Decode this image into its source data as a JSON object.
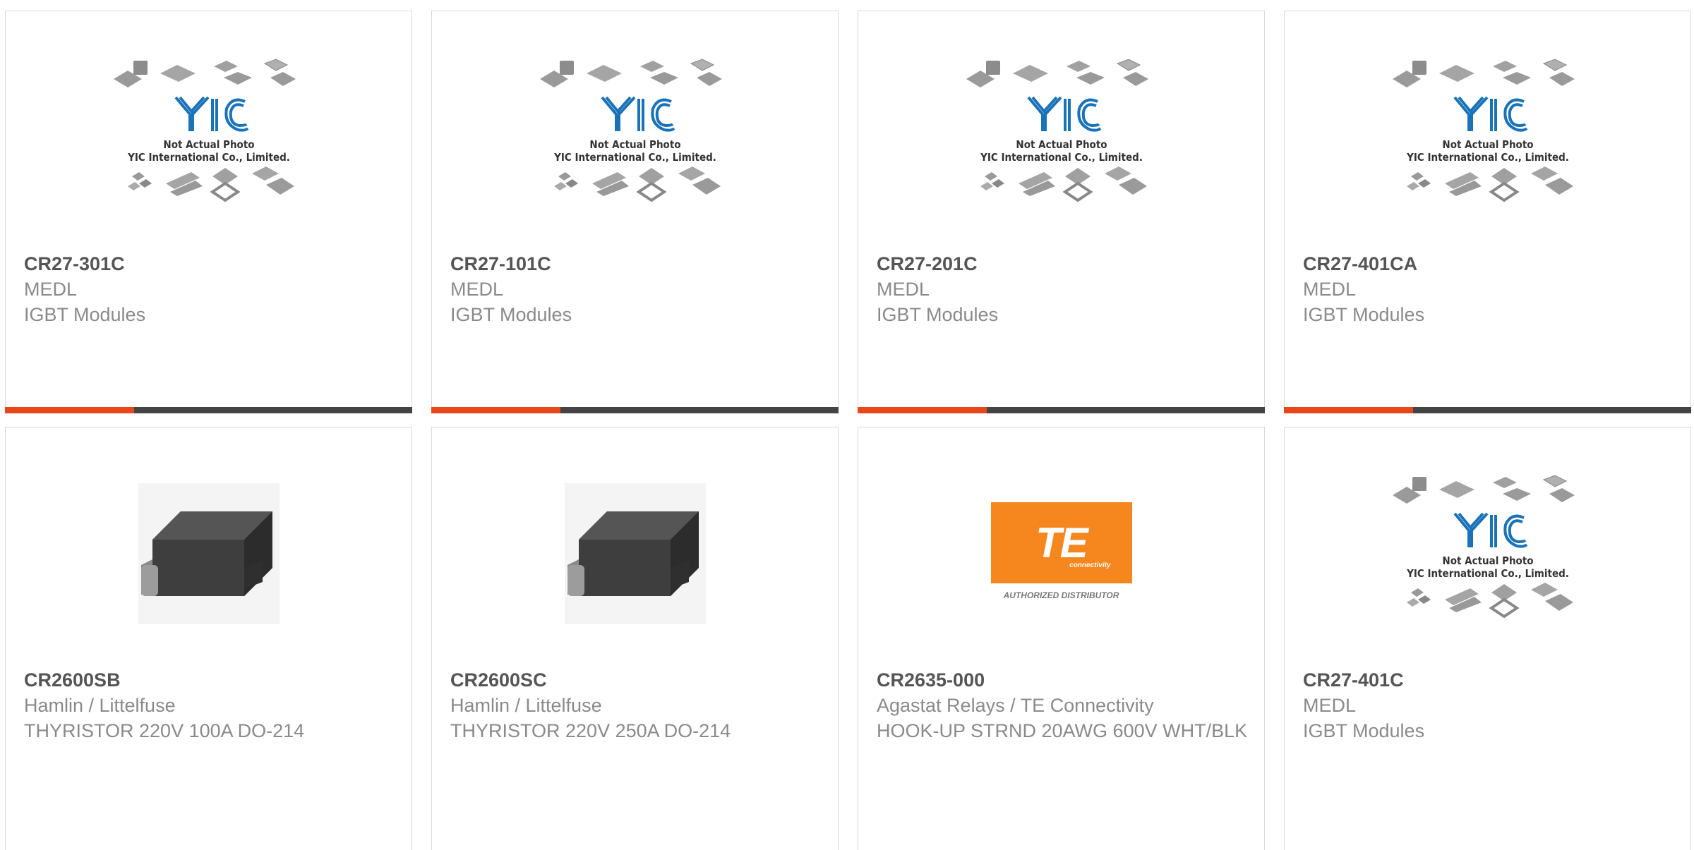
{
  "placeholder": {
    "line1": "Not Actual Photo",
    "line2": "YIC International Co., Limited.",
    "logo": "YIC"
  },
  "te": {
    "logo_text": "TE",
    "sub_text": "connectivity",
    "distributor": "AUTHORIZED DISTRIBUTOR"
  },
  "products": [
    {
      "pn": "CR27-301C",
      "mfr": "MEDL",
      "desc": "IGBT Modules",
      "image": "yic-placeholder"
    },
    {
      "pn": "CR27-101C",
      "mfr": "MEDL",
      "desc": "IGBT Modules",
      "image": "yic-placeholder"
    },
    {
      "pn": "CR27-201C",
      "mfr": "MEDL",
      "desc": "IGBT Modules",
      "image": "yic-placeholder"
    },
    {
      "pn": "CR27-401CA",
      "mfr": "MEDL",
      "desc": "IGBT Modules",
      "image": "yic-placeholder"
    },
    {
      "pn": "CR2600SB",
      "mfr": "Hamlin / Littelfuse",
      "desc": "THYRISTOR 220V 100A DO-214",
      "image": "do214-package"
    },
    {
      "pn": "CR2600SC",
      "mfr": "Hamlin / Littelfuse",
      "desc": "THYRISTOR 220V 250A DO-214",
      "image": "do214-package"
    },
    {
      "pn": "CR2635-000",
      "mfr": "Agastat Relays / TE Connectivity",
      "desc": "HOOK-UP STRND 20AWG 600V WHT/BLK",
      "image": "te-connectivity-logo"
    },
    {
      "pn": "CR27-401C",
      "mfr": "MEDL",
      "desc": "IGBT Modules",
      "image": "yic-placeholder"
    }
  ],
  "colors": {
    "accent": "#e8471b",
    "bar": "#444444",
    "te_orange": "#f6871f",
    "yic_blue": "#1a73b8"
  }
}
